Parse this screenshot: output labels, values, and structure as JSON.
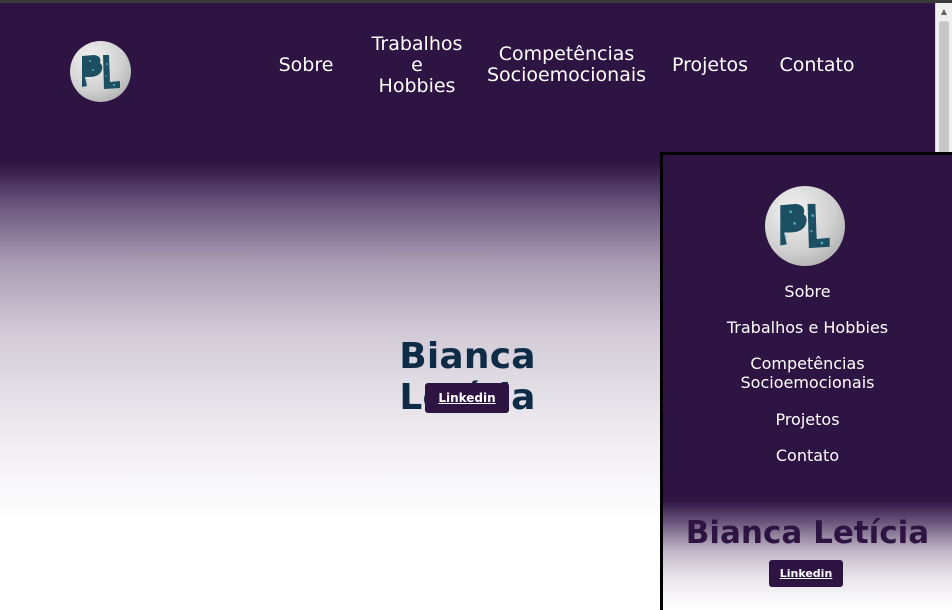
{
  "brand": {
    "logo_alt": "BL logo"
  },
  "nav": [
    {
      "label": "Sobre"
    },
    {
      "label": "Trabalhos e Hobbies",
      "lines": [
        "Trabalhos",
        "e",
        "Hobbies"
      ]
    },
    {
      "label": "Competências Socioemocionais",
      "lines": [
        "Competências",
        "Socioemocionais"
      ]
    },
    {
      "label": "Projetos"
    },
    {
      "label": "Contato"
    }
  ],
  "hero": {
    "title": "Bianca Letícia",
    "button_label": "Linkedin"
  },
  "mobile_preview": {
    "nav": [
      {
        "label": "Sobre"
      },
      {
        "label": "Trabalhos e Hobbies"
      },
      {
        "label": "Competências Socioemocionais",
        "lines": [
          "Competências",
          "Socioemocionais"
        ]
      },
      {
        "label": "Projetos"
      },
      {
        "label": "Contato"
      }
    ],
    "title": "Bianca Letícia",
    "button_label": "Linkedin"
  },
  "colors": {
    "primary": "#2e1442",
    "hero_title": "#0f2c46",
    "logo_letters": "#1d4f63"
  }
}
